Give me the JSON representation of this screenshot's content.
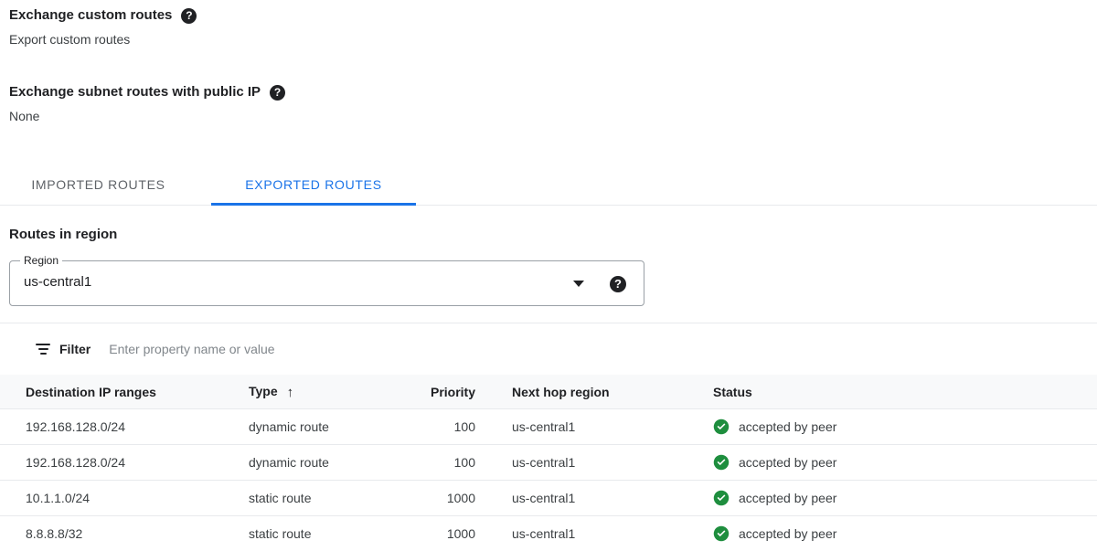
{
  "info_blocks": [
    {
      "title": "Exchange custom routes",
      "value": "Export custom routes",
      "help_icon": "help-circle-icon"
    },
    {
      "title": "Exchange subnet routes with public IP",
      "value": "None",
      "help_icon": "help-circle-icon"
    }
  ],
  "tabs": [
    {
      "label": "IMPORTED ROUTES",
      "active": false
    },
    {
      "label": "EXPORTED ROUTES",
      "active": true
    }
  ],
  "section": {
    "title": "Routes in region",
    "region_field": {
      "label": "Region",
      "value": "us-central1",
      "arrow_icon": "chevron-down-icon",
      "help_icon": "help-circle-icon"
    }
  },
  "filter": {
    "icon": "filter-icon",
    "label": "Filter",
    "placeholder": "Enter property name or value",
    "value": ""
  },
  "table": {
    "columns": {
      "destination": "Destination IP ranges",
      "type": "Type",
      "type_sort": "↑",
      "priority": "Priority",
      "next_hop": "Next hop region",
      "status": "Status"
    },
    "rows": [
      {
        "destination": "192.168.128.0/24",
        "type": "dynamic route",
        "priority": "100",
        "next_hop": "us-central1",
        "status": "accepted by peer",
        "status_icon": "check-circle-icon"
      },
      {
        "destination": "192.168.128.0/24",
        "type": "dynamic route",
        "priority": "100",
        "next_hop": "us-central1",
        "status": "accepted by peer",
        "status_icon": "check-circle-icon"
      },
      {
        "destination": "10.1.1.0/24",
        "type": "static route",
        "priority": "1000",
        "next_hop": "us-central1",
        "status": "accepted by peer",
        "status_icon": "check-circle-icon"
      },
      {
        "destination": "8.8.8.8/32",
        "type": "static route",
        "priority": "1000",
        "next_hop": "us-central1",
        "status": "accepted by peer",
        "status_icon": "check-circle-icon"
      }
    ]
  },
  "colors": {
    "accent_blue": "#1a73e8",
    "status_green": "#1e8e3e",
    "header_bg": "#f8f9fa",
    "divider": "#e8eaed",
    "text_primary": "#202124",
    "text_secondary": "#5f6368"
  }
}
